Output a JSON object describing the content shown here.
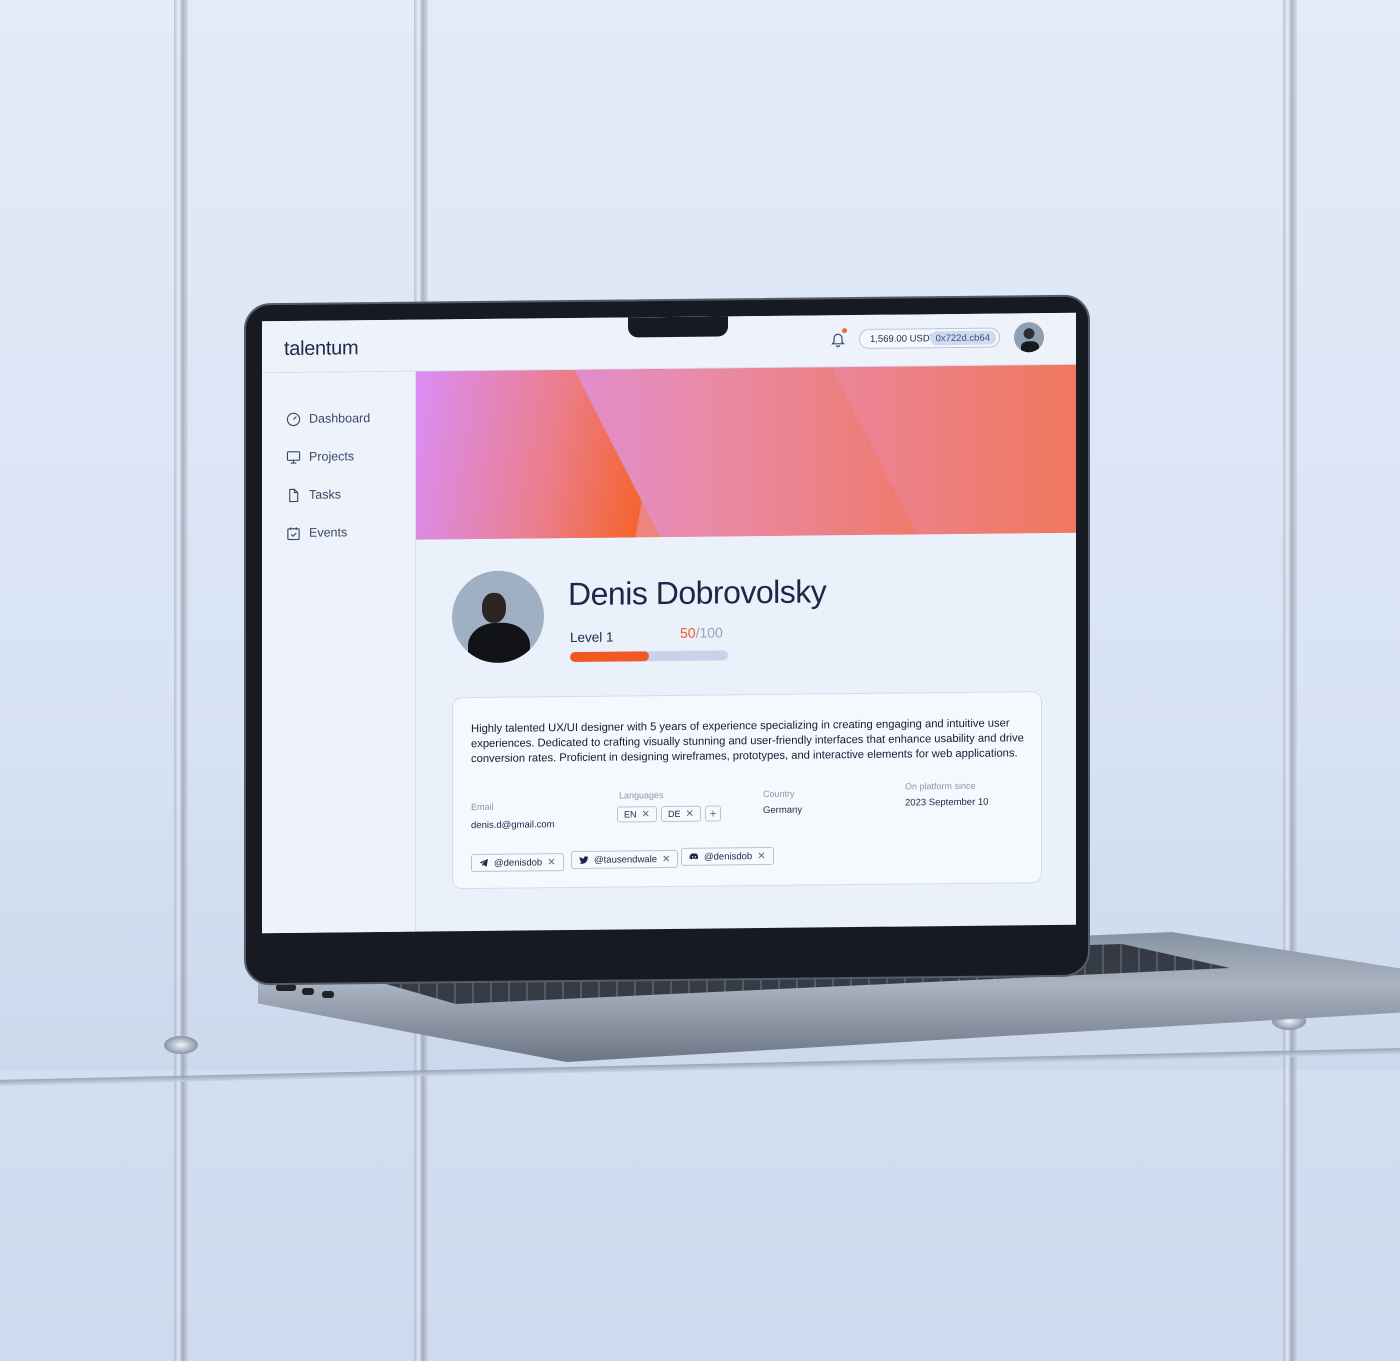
{
  "app": {
    "logo": "talentum"
  },
  "header": {
    "balance": "1,569.00 USDT",
    "wallet_address": "0x722d.cb64",
    "notification_dot_color": "#f26a36"
  },
  "sidebar": {
    "items": [
      {
        "label": "Dashboard",
        "icon": "gauge-icon"
      },
      {
        "label": "Projects",
        "icon": "presentation-icon"
      },
      {
        "label": "Tasks",
        "icon": "file-icon"
      },
      {
        "label": "Events",
        "icon": "calendar-check-icon"
      }
    ]
  },
  "profile": {
    "name": "Denis Dobrovolsky",
    "level_label": "Level 1",
    "score_current": "50",
    "score_max": "/100",
    "progress_fraction": 0.5,
    "bio": "Highly talented UX/UI designer with 5 years of experience specializing in creating engaging and intuitive user experiences. Dedicated to crafting visually stunning and user-friendly interfaces that enhance usability and drive conversion rates. Proficient in designing wireframes, prototypes, and interactive elements for web applications.",
    "email_label": "Email",
    "email": "denis.d@gmail.com",
    "languages_label": "Languages",
    "languages": [
      "EN",
      "DE"
    ],
    "country_label": "Country",
    "country": "Germany",
    "since_label": "On platform since",
    "since": "2023 September 10",
    "socials": [
      {
        "handle": "@denisdob",
        "icon": "telegram-icon"
      },
      {
        "handle": "@tausendwale",
        "icon": "twitter-icon"
      },
      {
        "handle": "@denisdob",
        "icon": "discord-icon"
      }
    ]
  },
  "colors": {
    "accent": "#f05a22",
    "text_primary": "#1c2747",
    "progress_track": "#c9d2ec"
  }
}
